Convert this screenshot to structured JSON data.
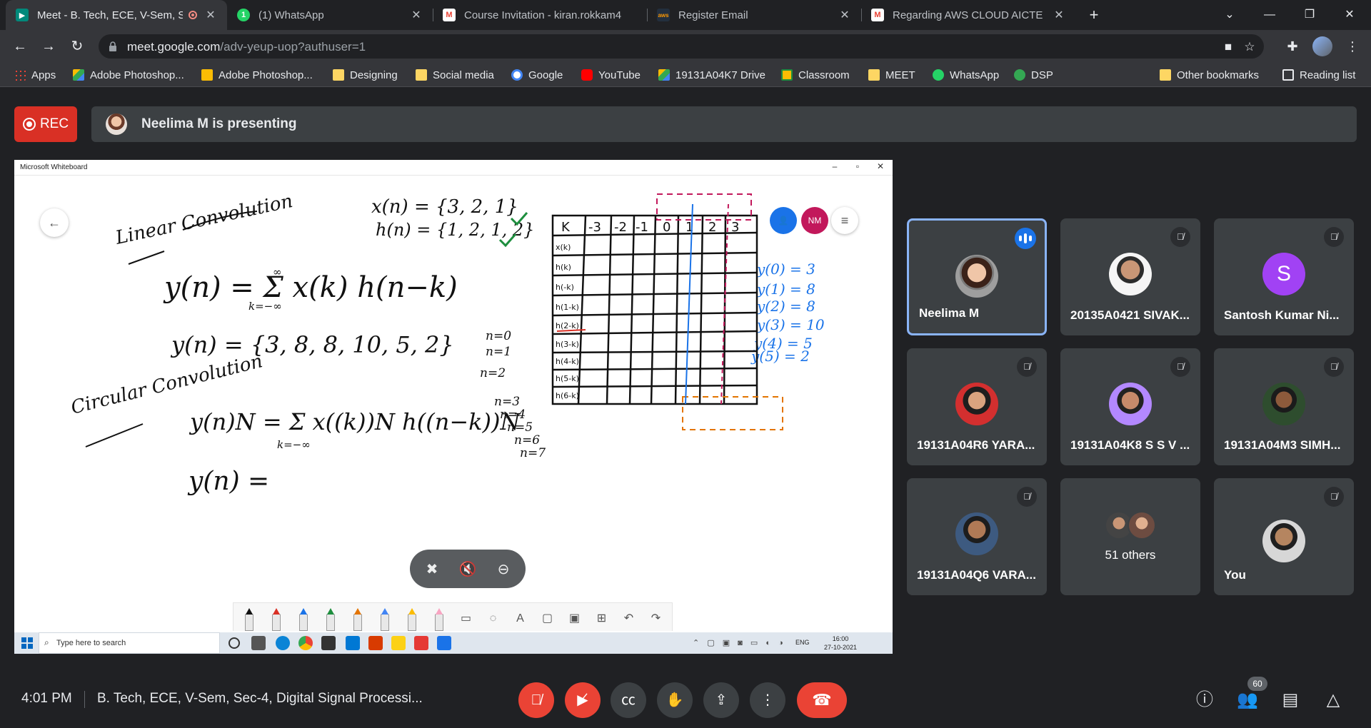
{
  "browser": {
    "tabs": [
      {
        "title": "Meet - B. Tech, ECE, V-Sem, S",
        "favicon": "meet-icon",
        "color": "#00897b",
        "active": true
      },
      {
        "title": "(1) WhatsApp",
        "favicon": "whatsapp-icon",
        "color": "#25d366",
        "active": false
      },
      {
        "title": "Course Invitation - kiran.rokkam4",
        "favicon": "gmail-icon",
        "color": "#ea4335",
        "active": false
      },
      {
        "title": "Register Email",
        "favicon": "aws-icon",
        "color": "#232f3e",
        "active": false
      },
      {
        "title": "Regarding AWS CLOUD AICTE Int",
        "favicon": "gmail-icon",
        "color": "#ea4335",
        "active": false
      }
    ],
    "url_host": "meet.google.com",
    "url_path": "/adv-yeup-uop?authuser=1",
    "bookmarks": [
      {
        "label": "Apps",
        "icon": "apps-grid-icon"
      },
      {
        "label": "Adobe Photoshop...",
        "icon": "drive-icon"
      },
      {
        "label": "Adobe Photoshop...",
        "icon": "drive-icon"
      },
      {
        "label": "Designing",
        "icon": "folder-icon"
      },
      {
        "label": "Social media",
        "icon": "folder-icon"
      },
      {
        "label": "Google",
        "icon": "google-icon"
      },
      {
        "label": "YouTube",
        "icon": "youtube-icon"
      },
      {
        "label": "19131A04K7 Drive",
        "icon": "drive-icon"
      },
      {
        "label": "Classroom",
        "icon": "classroom-icon"
      },
      {
        "label": "MEET",
        "icon": "folder-icon"
      },
      {
        "label": "WhatsApp",
        "icon": "whatsapp-icon"
      },
      {
        "label": "DSP",
        "icon": "dsp-icon"
      }
    ],
    "other_bookmarks": "Other bookmarks",
    "reading_list": "Reading list"
  },
  "meet": {
    "rec_label": "REC",
    "presenting_text": "Neelima M is presenting",
    "whiteboard": {
      "window_title": "Microsoft Whiteboard",
      "avatar_initials": "NM",
      "taskbar_search": "Type here to search",
      "lang": "ENG",
      "time": "16:00",
      "date": "27-10-2021",
      "handwriting": {
        "x_def": "x(n) = {3, 2, 1}",
        "h_def": "h(n) = {1, 2, 1, 2}",
        "linear_title": "Linear Convolution",
        "linear_formula": "y(n) = Σ x(k) h(n−k)",
        "sum_lower": "k=−∞",
        "sum_upper": "∞",
        "linear_result": "y(n) = {3, 8, 8, 10, 5, 2}",
        "circular_title": "Circular Convolution",
        "circular_formula": "y(n)N = Σ x((k))N h((n−k))N",
        "circular_lower": "k=−∞",
        "blank_eq": "y(n) =",
        "n_values": [
          "n=0",
          "n=1",
          "n=2",
          "n=3",
          "n=4",
          "n=5",
          "n=6",
          "n=7"
        ],
        "y_values": [
          "y(0) = 3",
          "y(1) = 8",
          "y(2) = 8",
          "y(3) = 10",
          "y(4) = 5",
          "y(5) = 2"
        ],
        "table_header": [
          "K",
          "-3",
          "-2",
          "-1",
          "0",
          "1",
          "2",
          "3"
        ],
        "table_rows": [
          "x(k)",
          "h(k)",
          "h(-k)",
          "h(1-k)",
          "h(2-k)",
          "h(3-k)",
          "h(4-k)",
          "h(5-k)",
          "h(6-k)"
        ]
      }
    },
    "participants": [
      {
        "name": "Neelima M",
        "speaking": true,
        "muted": false,
        "avatar": "photo"
      },
      {
        "name": "20135A0421 SIVAK...",
        "speaking": false,
        "muted": true,
        "avatar": "photo"
      },
      {
        "name": "Santosh Kumar Ni...",
        "speaking": false,
        "muted": true,
        "avatar": "letter",
        "letter": "S",
        "color": "#a142f4"
      },
      {
        "name": "19131A04R6 YARA...",
        "speaking": false,
        "muted": true,
        "avatar": "photo"
      },
      {
        "name": "19131A04K8 S S V ...",
        "speaking": false,
        "muted": true,
        "avatar": "photo"
      },
      {
        "name": "19131A04M3 SIMH...",
        "speaking": false,
        "muted": true,
        "avatar": "photo"
      },
      {
        "name": "19131A04Q6 VARA...",
        "speaking": false,
        "muted": true,
        "avatar": "photo"
      },
      {
        "name": "51 others",
        "speaking": false,
        "muted": false,
        "avatar": "group"
      },
      {
        "name": "You",
        "speaking": false,
        "muted": true,
        "avatar": "photo"
      }
    ],
    "bottom": {
      "time": "4:01 PM",
      "title": "B. Tech, ECE, V-Sem, Sec-4, Digital Signal Processi...",
      "participant_count": "60"
    }
  }
}
